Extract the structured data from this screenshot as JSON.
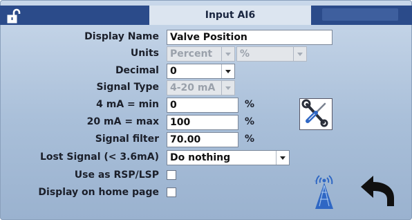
{
  "header": {
    "title": "Input AI6"
  },
  "form": {
    "display_name": {
      "label": "Display Name",
      "value": "Valve Position"
    },
    "units": {
      "label": "Units",
      "type_value": "Percent",
      "symbol_value": "%"
    },
    "decimal": {
      "label": "Decimal",
      "value": "0"
    },
    "signal_type": {
      "label": "Signal Type",
      "value": "4-20 mA"
    },
    "min": {
      "label": "4 mA = min",
      "value": "0",
      "unit": "%"
    },
    "max": {
      "label": "20 mA = max",
      "value": "100",
      "unit": "%"
    },
    "signal_filter": {
      "label": "Signal filter",
      "value": "70.00",
      "unit": "%"
    },
    "lost_signal": {
      "label": "Lost Signal (< 3.6mA)",
      "value": "Do nothing"
    },
    "use_as_rsp": {
      "label": "Use as RSP/LSP",
      "checked": false
    },
    "display_home": {
      "label": "Display on home page",
      "checked": false
    }
  },
  "icons": {
    "lock": "unlocked-padlock-icon",
    "tools": "screwdriver-wrench-icon",
    "wireless": "wireless-tower-icon",
    "back": "back-arrow-icon"
  },
  "colors": {
    "titlebar": "#2b4b8a",
    "background": "#b3c7de",
    "accent_blue": "#2f67c4"
  }
}
